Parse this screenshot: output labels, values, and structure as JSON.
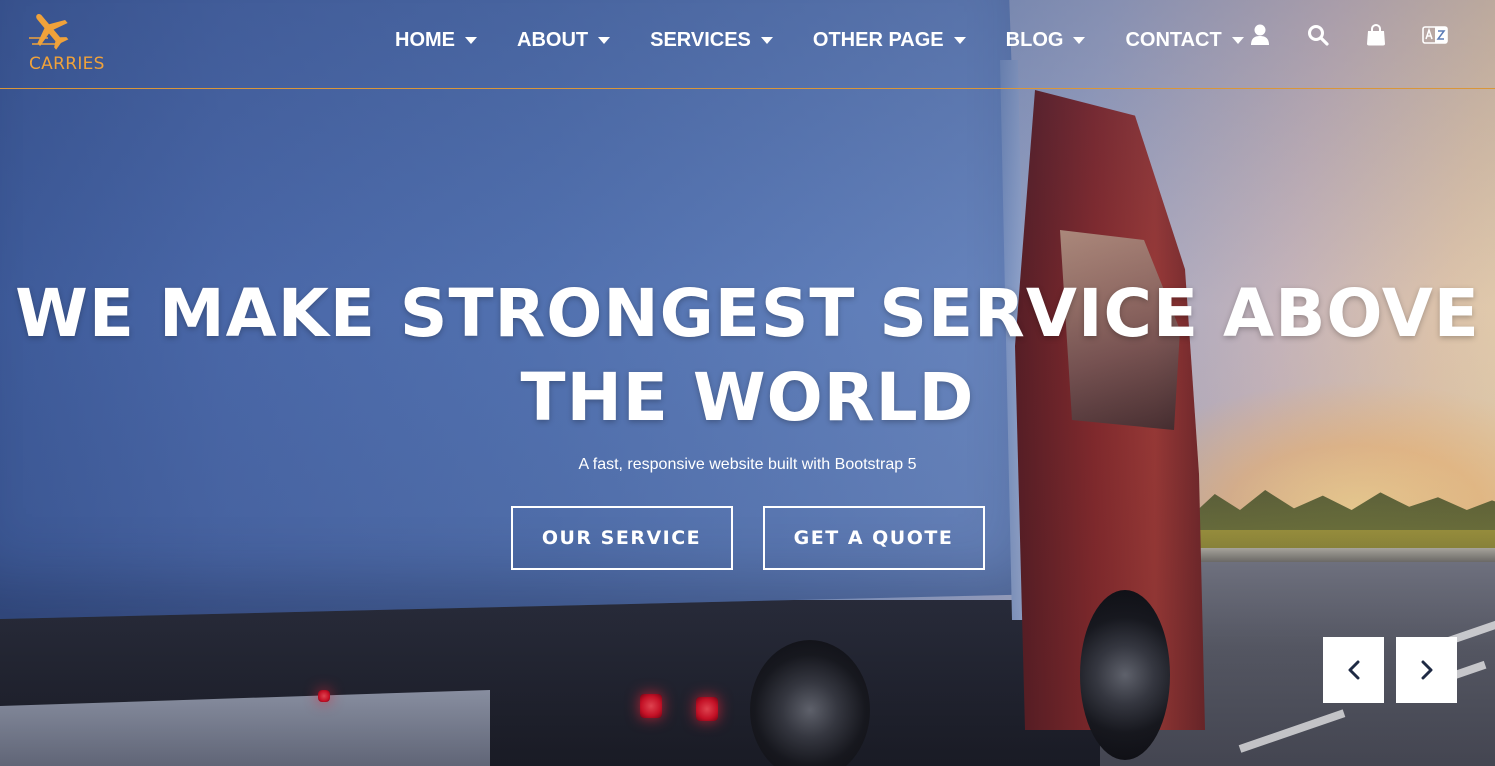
{
  "brand": {
    "name": "CARRIES",
    "accent_color": "#f0a23a",
    "logo_icon": "airplane-icon"
  },
  "nav": {
    "items": [
      {
        "label": "HOME"
      },
      {
        "label": "ABOUT"
      },
      {
        "label": "SERVICES"
      },
      {
        "label": "OTHER PAGE"
      },
      {
        "label": "BLOG"
      },
      {
        "label": "CONTACT"
      }
    ],
    "icons": [
      "user-icon",
      "search-icon",
      "shopping-bag-icon",
      "language-icon"
    ]
  },
  "hero": {
    "title_line1": "WE MAKE STRONGEST SERVICE ABOVE",
    "title_line2": "THE WORLD",
    "subtitle": "A fast, responsive website built with Bootstrap 5",
    "buttons": {
      "primary": "OUR SERVICE",
      "secondary": "GET A QUOTE"
    }
  },
  "carousel": {
    "prev_icon": "chevron-left-icon",
    "next_icon": "chevron-right-icon"
  }
}
